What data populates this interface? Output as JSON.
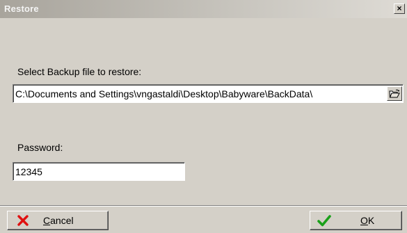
{
  "window": {
    "title": "Restore",
    "close_glyph": "×"
  },
  "backup": {
    "label": "Select Backup file to restore:",
    "path_value": "C:\\Documents and Settings\\vngastaldi\\Desktop\\Babyware\\BackData\\",
    "browse_icon": "folder-open-icon"
  },
  "password": {
    "label": "Password:",
    "value": "12345"
  },
  "buttons": {
    "cancel": {
      "mnemonic": "C",
      "rest": "ancel",
      "icon": "red-x-icon",
      "icon_color": "#e01010"
    },
    "ok": {
      "mnemonic": "O",
      "rest": "K",
      "icon": "green-check-icon",
      "icon_color": "#1aa01a"
    }
  }
}
